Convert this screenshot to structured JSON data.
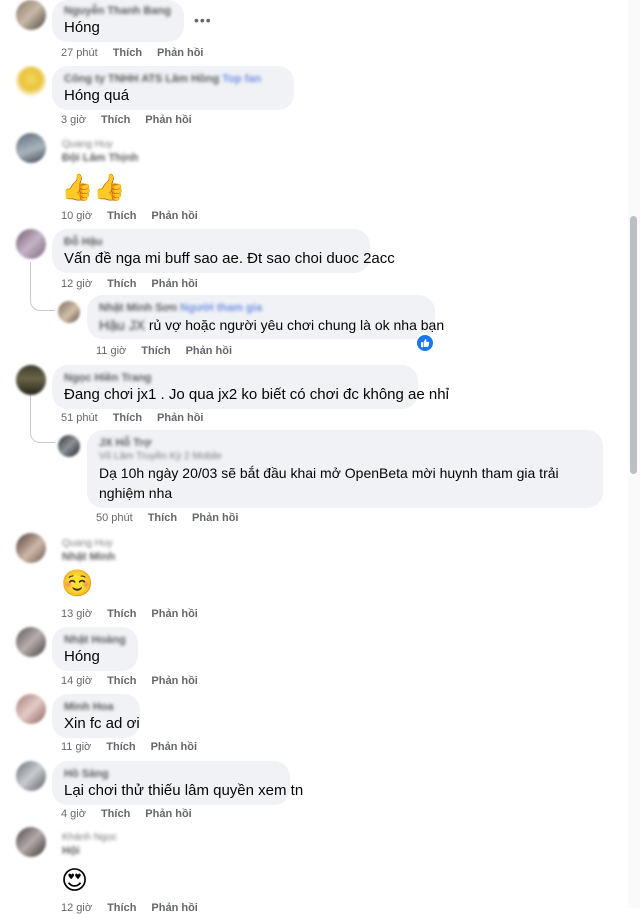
{
  "colors": {
    "bubble": "#f0f2f5",
    "meta": "#65676b",
    "like": "#1877f2"
  },
  "comments": [
    {
      "name": "Nguyễn Thanh Bang",
      "text": "Hóng",
      "time": "27 phút",
      "like": "Thích",
      "reply": "Phản hồi"
    },
    {
      "name": "Công ty TNHH ATS Lâm Hồng",
      "name_tag": "Top fan",
      "text": "Hóng quá",
      "time": "3 giờ",
      "like": "Thích",
      "reply": "Phản hồi"
    },
    {
      "name": "Quang Huy",
      "sub": "Đội Lâm Thịnh",
      "emoji": "👍👍",
      "emoji_name": "thumbs-up-emoji",
      "time": "10 giờ",
      "like": "Thích",
      "reply": "Phản hồi"
    },
    {
      "name": "Đỗ Hậu",
      "text": "Vấn đề nga mi buff sao ae. Đt sao choi duoc 2acc",
      "time": "12 giờ",
      "like": "Thích",
      "reply": "Phản hồi"
    },
    {
      "name": "Nhật Minh Sơn",
      "name_tag": "Người tham gia",
      "prefix": "Hậu JX",
      "text": "rủ vợ hoặc người yêu chơi chung là ok nha bạn",
      "time": "11 giờ",
      "like": "Thích",
      "reply": "Phản hồi"
    },
    {
      "name": "Ngọc Hiền Trang",
      "text": "Đang chơi jx1 . Jo qua jx2 ko biết có chơi đc không ae nhỉ",
      "time": "51 phút",
      "like": "Thích",
      "reply": "Phản hồi"
    },
    {
      "name": "JX Hỗ Trợ",
      "sub": "Võ Lâm Truyền Kỳ 2 Mobile",
      "text": "Dạ 10h ngày 20/03 sẽ bắt đầu khai mở OpenBeta mời huynh tham gia trải nghiệm nha",
      "time": "50 phút",
      "like": "Thích",
      "reply": "Phản hồi"
    },
    {
      "name": "Quang Huy",
      "sub": "Nhật Minh",
      "emoji": "☺️",
      "emoji_name": "smiling-emoji",
      "time": "13 giờ",
      "like": "Thích",
      "reply": "Phản hồi"
    },
    {
      "name": "Nhật Hoàng",
      "text": "Hóng",
      "time": "14 giờ",
      "like": "Thích",
      "reply": "Phản hồi"
    },
    {
      "name": "Minh Hoa",
      "text": "Xin fc ad ơi",
      "time": "11 giờ",
      "like": "Thích",
      "reply": "Phản hồi"
    },
    {
      "name": "Hồ Sáng",
      "text": "Lại chơi thử thiếu lâm quyền xem tn",
      "time": "4 giờ",
      "like": "Thích",
      "reply": "Phản hồi"
    },
    {
      "name": "Khánh Ngọc",
      "sub": "Hội",
      "emoji": "😍",
      "emoji_name": "heart-eyes-emoji",
      "time": "12 giờ",
      "like": "Thích",
      "reply": "Phản hồi"
    }
  ]
}
